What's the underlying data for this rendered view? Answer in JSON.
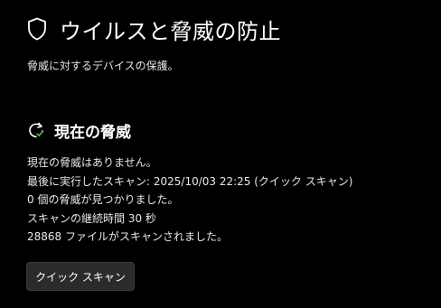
{
  "header": {
    "icon": "shield-icon",
    "title": "ウイルスと脅威の防止"
  },
  "subtitle": "脅威に対するデバイスの保護。",
  "current_threats": {
    "icon": "scan-refresh-icon",
    "accent_color": "#4caf50",
    "title": "現在の脅威",
    "lines": [
      "現在の脅威はありません。",
      "最後に実行したスキャン: 2025/10/03 22:25 (クイック スキャン)",
      "0 個の脅威が見つかりました。",
      "スキャンの継続時間 30 秒",
      "28868 ファイルがスキャンされました。"
    ],
    "button_label": "クイック スキャン"
  }
}
